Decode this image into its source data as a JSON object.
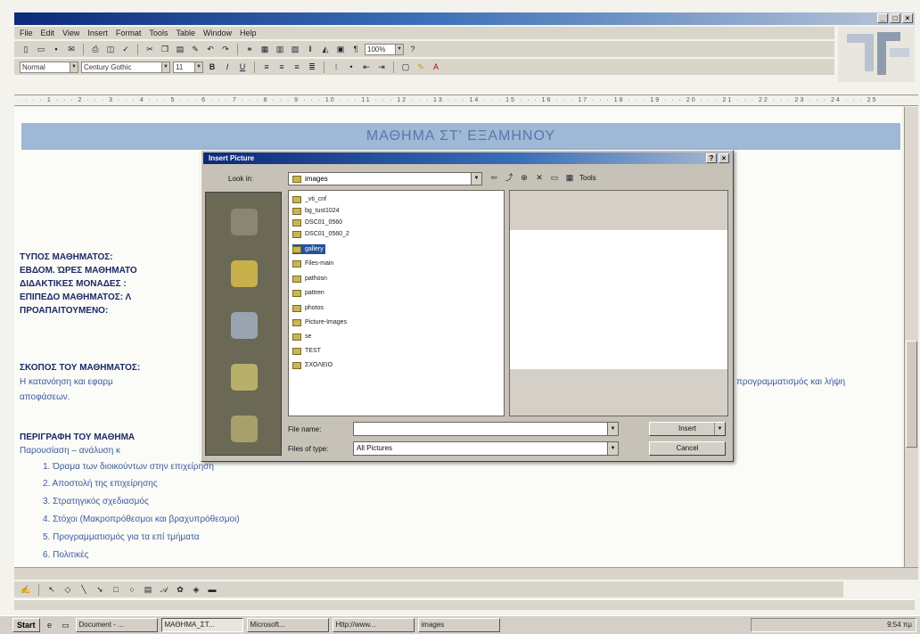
{
  "window": {
    "title": ""
  },
  "menu": [
    "File",
    "Edit",
    "View",
    "Insert",
    "Format",
    "Tools",
    "Table",
    "Window",
    "Help"
  ],
  "toolbar": {
    "zoom": "100%",
    "style": "Normal",
    "font": "Century Gothic",
    "size": "11"
  },
  "document": {
    "banner": "ΜΑΘΗΜΑ ΣΤ' ΕΞΑΜΗΝΟΥ",
    "fields": [
      "ΤΥΠΟΣ ΜΑΘΗΜΑΤΟΣ:",
      "ΕΒΔΟΜ. ΏΡΕΣ ΜΑΘΗΜΑΤΟ",
      "ΔΙΔΑΚΤΙΚΕΣ ΜΟΝΑΔΕΣ :",
      "ΕΠΙΠΕΔΟ ΜΑΘΗΜΑΤΟΣ:  Λ",
      "ΠΡΟΑΠΑΙΤΟΥΜΕΝΟ:"
    ],
    "aim_heading": "ΣΚΟΠΟΣ ΤΟΥ ΜΑΘΗΜΑΤΟΣ:",
    "aim_line1_left": "Η κατανόηση και εφαρμ",
    "aim_line1_right": "προγραμματισμός και λήψη",
    "aim_line2": "αποφάσεων.",
    "desc_heading": "ΠΕΡΙΓΡΑΦΗ ΤΟΥ ΜΑΘΗΜΑ",
    "desc_intro": "Παρουσίαση – ανάλυση κ",
    "list": [
      "1.  Όραμα των διοικούντων στην επιχείρηση",
      "2.  Αποστολή της επιχείρησης",
      "3.  Στρατηγικός σχεδιασμός",
      "4.  Στόχοι (Μακροπρόθεσμοι και βραχυπρόθεσμοι)",
      "5.  Προγραμματισμός για τα επί τμήματα",
      "6.  Πολιτικές"
    ]
  },
  "dialog": {
    "title": "Insert Picture",
    "look_in_label": "Look in:",
    "look_in_value": "images",
    "tools_label": "Tools",
    "files": [
      "_vti_cnf",
      "bg_tust1024",
      "DSC01_0560",
      "DSC01_0560_2",
      "gallery",
      "Files-main",
      "pathosn",
      "pattren",
      "photos",
      "Picture-Images",
      "se",
      "TEST",
      "ΣΧΟΛΕΙΟ"
    ],
    "selected_index": 4,
    "file_name_label": "File name:",
    "file_name_value": "",
    "file_type_label": "Files of type:",
    "file_type_value": "All Pictures",
    "insert_label": "Insert",
    "cancel_label": "Cancel"
  },
  "taskbar": {
    "start": "Start",
    "tasks": [
      "Document - ...",
      "ΜΑΘΗΜΑ_ΣΤ...",
      "Microsoft...",
      "Http://www...",
      "images"
    ],
    "clock": "9:54 πμ"
  },
  "colors": {
    "banner": "#9eb8d6",
    "title_bar": "#0c2a7a",
    "selection": "#24539b"
  }
}
